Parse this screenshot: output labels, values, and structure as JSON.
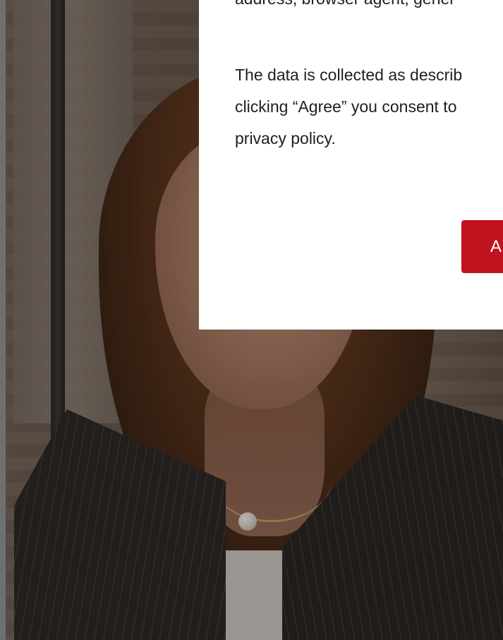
{
  "consent_dialog": {
    "text_partial_top": "address, browser agent, gener",
    "paragraph_lines": [
      "The data is collected as describ",
      "clicking “Agree” you consent to",
      "privacy policy."
    ],
    "agree_label": "A",
    "accent_color": "#c0131f"
  }
}
